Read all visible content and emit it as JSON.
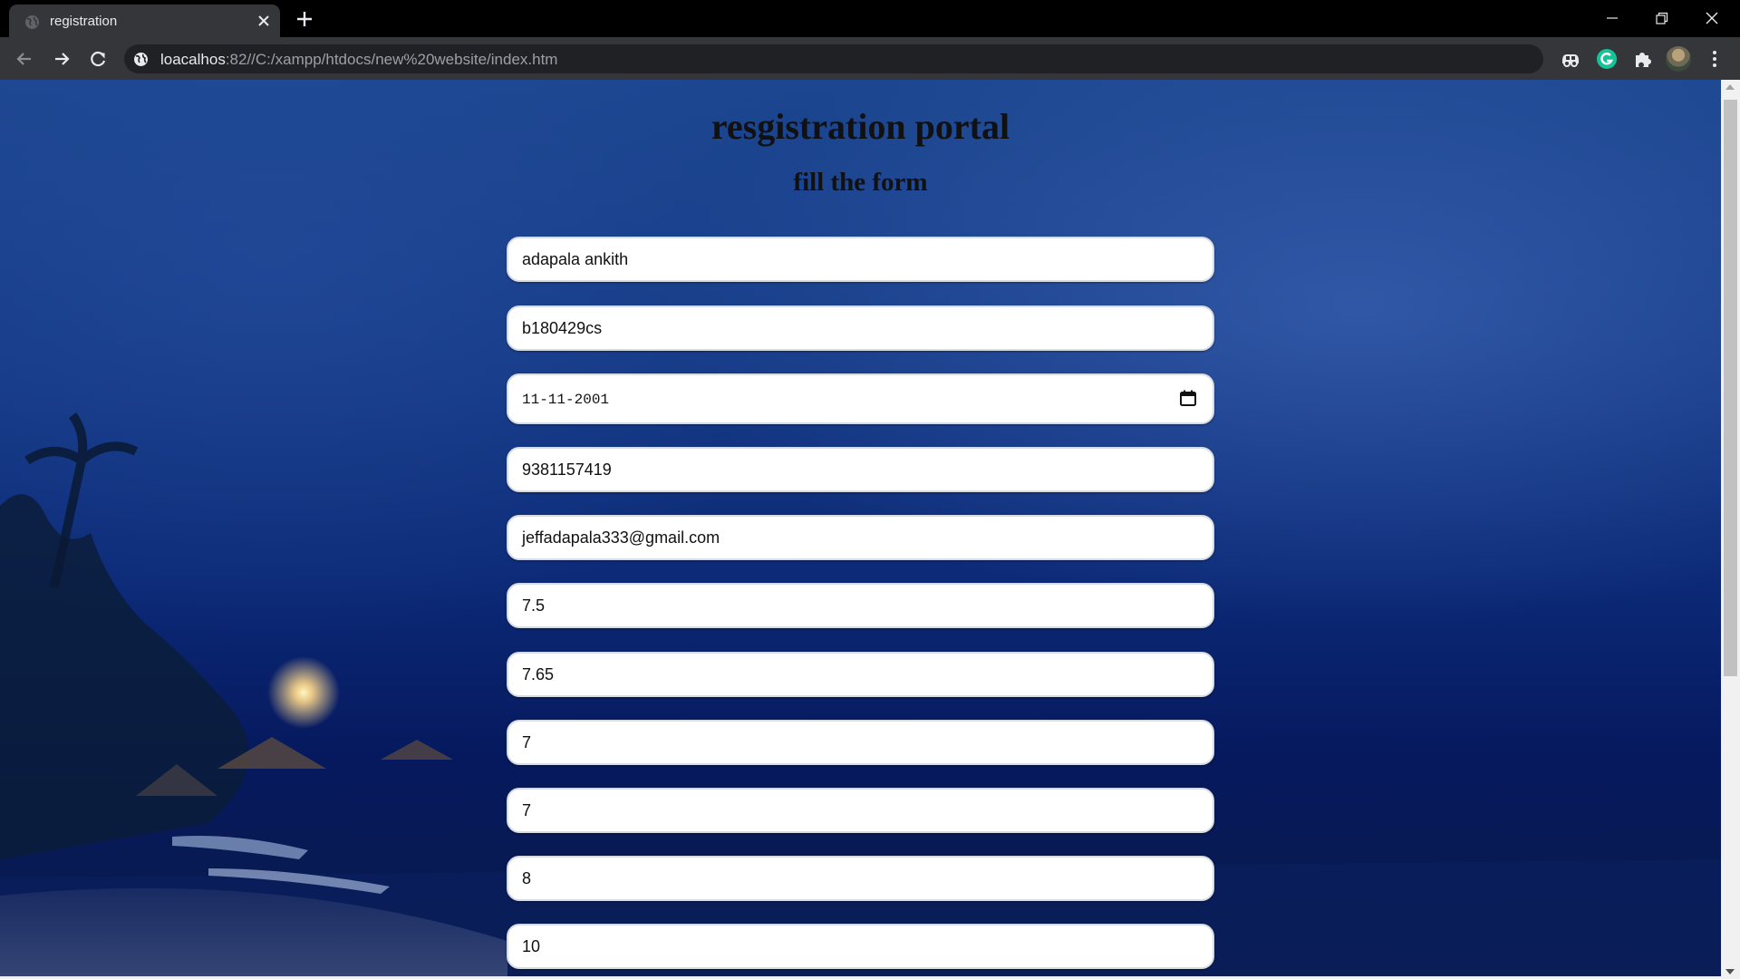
{
  "browser": {
    "tab_title": "registration",
    "url_host": "loacalhos",
    "url_rest": ":82//C:/xampp/htdocs/new%20website/index.htm"
  },
  "page": {
    "title": "resgistration portal",
    "subtitle": "fill the form"
  },
  "form": {
    "fields": [
      {
        "value": "adapala ankith"
      },
      {
        "value": "b180429cs"
      },
      {
        "value": "11-11-2001"
      },
      {
        "value": "9381157419"
      },
      {
        "value": "jeffadapala333@gmail.com"
      },
      {
        "value": "7.5"
      },
      {
        "value": "7.65"
      },
      {
        "value": "7"
      },
      {
        "value": "7"
      },
      {
        "value": "8"
      },
      {
        "value": "10"
      }
    ]
  },
  "icons": {
    "favicon": "globe-icon",
    "tab_close": "close-icon",
    "new_tab": "plus-icon",
    "back": "arrow-left-icon",
    "forward": "arrow-right-icon",
    "reload": "reload-icon",
    "site_info": "globe-icon",
    "extension_1": "extension-icon",
    "grammarly": "grammarly-icon",
    "extensions": "puzzle-icon",
    "menu": "kebab-menu-icon",
    "date_picker": "calendar-icon"
  },
  "colors": {
    "chrome_dark": "#000000",
    "toolbar": "#35363a",
    "omnibox": "#202124",
    "field_bg": "#ffffff",
    "heading": "#111111",
    "grammarly_green": "#15c39a"
  }
}
